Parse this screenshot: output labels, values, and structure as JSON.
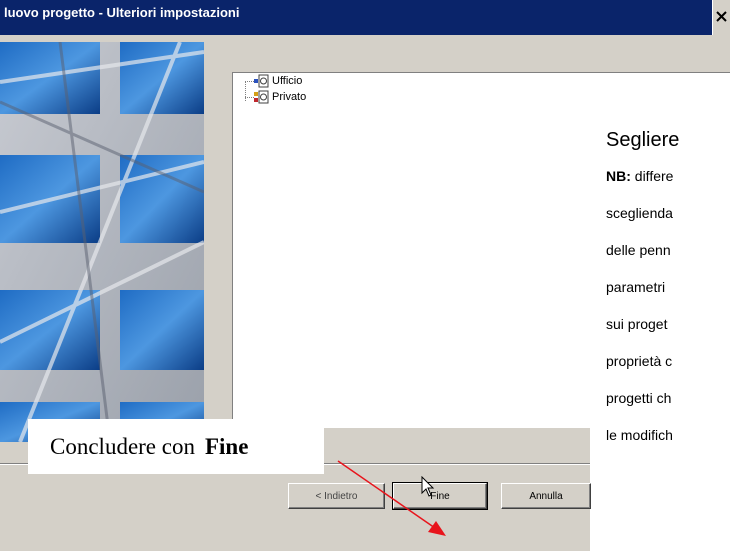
{
  "window": {
    "title": "luovo progetto - Ulteriori impostazioni",
    "close_icon": "close-icon"
  },
  "tree": {
    "items": [
      {
        "label": "Ufficio",
        "icon": "project-node-icon"
      },
      {
        "label": "Privato",
        "icon": "project-node-icon"
      }
    ]
  },
  "note": {
    "title": "Segliere",
    "lines": [
      {
        "bold": "NB:",
        "text": " differe"
      },
      {
        "bold": "",
        "text": "sceglienda"
      },
      {
        "bold": "",
        "text": "delle penn"
      },
      {
        "bold": "",
        "text": "parametri"
      },
      {
        "bold": "",
        "text": "sui proget"
      },
      {
        "bold": "",
        "text": "proprietà c"
      },
      {
        "bold": "",
        "text": "progetti ch"
      },
      {
        "bold": "",
        "text": "le modifich"
      }
    ]
  },
  "callout": {
    "text": "Concludere con",
    "bold": "Fine"
  },
  "buttons": {
    "back": "< Indietro",
    "finish": "Fine",
    "cancel": "Annulla"
  },
  "colors": {
    "titlebar": "#0a246a",
    "arrow": "#e8141c",
    "dialog": "#d4d0c8"
  }
}
